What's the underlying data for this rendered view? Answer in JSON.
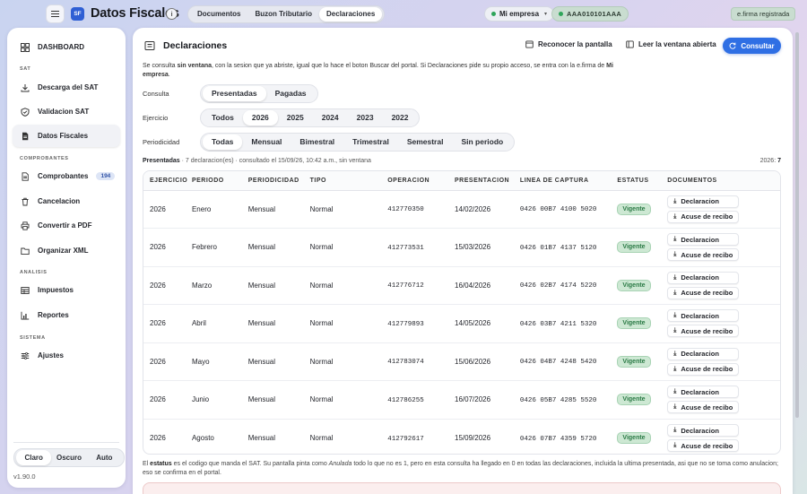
{
  "topbar": {
    "logo_text": "SF",
    "app_title": "Datos Fiscales",
    "info_icon": "info-icon",
    "tabs": [
      {
        "label": "Documentos",
        "active": false
      },
      {
        "label": "Buzon Tributario",
        "active": false
      },
      {
        "label": "Declaraciones",
        "active": true
      }
    ],
    "company": "Mi empresa",
    "rfc": "AAA010101AAA",
    "efirma": "e.firma registrada"
  },
  "sidebar": {
    "dashboard": "DASHBOARD",
    "sections": {
      "sat": "SAT",
      "comprobantes": "COMPROBANTES",
      "analisis": "ANALISIS",
      "sistema": "SISTEMA"
    },
    "items": {
      "descarga": "Descarga del SAT",
      "validacion": "Validacion SAT",
      "datos": "Datos Fiscales",
      "comprobantes": "Comprobantes",
      "comprobantes_count": "194",
      "cancelacion": "Cancelacion",
      "convertir": "Convertir a PDF",
      "organizar": "Organizar XML",
      "impuestos": "Impuestos",
      "reportes": "Reportes",
      "ajustes": "Ajustes"
    },
    "theme": {
      "claro": "Claro",
      "oscuro": "Oscuro",
      "auto": "Auto",
      "selected": "Claro"
    },
    "version": "v1.90.0"
  },
  "main": {
    "title": "Declaraciones",
    "reconocer": "Reconocer la pantalla",
    "leer": "Leer la ventana abierta",
    "consultar": "Consultar",
    "intro": {
      "p1": "Se consulta ",
      "b1": "sin ventana",
      "p2": ", con la sesion que ya abriste, igual que lo hace el boton Buscar del portal. Si Declaraciones pide su propio acceso, se entra con la e.firma de ",
      "b2": "Mi empresa",
      "p3": "."
    },
    "consulta_label": "Consulta",
    "consulta_opts": [
      "Presentadas",
      "Pagadas"
    ],
    "ejercicio_label": "Ejercicio",
    "ejercicio_opts": [
      "Todos",
      "2026",
      "2025",
      "2024",
      "2023",
      "2022"
    ],
    "periodicidad_label": "Periodicidad",
    "periodicidad_opts": [
      "Todas",
      "Mensual",
      "Bimestral",
      "Trimestral",
      "Semestral",
      "Sin periodo"
    ],
    "summary": {
      "bold": "Presentadas",
      "text": " · 7 declaracion(es) · consultado el 15/09/26, 10:42 a.m., sin ventana"
    },
    "year_count_label": "2026: ",
    "year_count": "7",
    "columns": [
      "EJERCICIO",
      "PERIODO",
      "PERIODICIDAD",
      "TIPO",
      "OPERACION",
      "PRESENTACION",
      "LINEA DE CAPTURA",
      "ESTATUS",
      "DOCUMENTOS"
    ],
    "doc_labels": {
      "declaracion": "Declaracion",
      "acuse": "Acuse de recibo"
    },
    "rows": [
      {
        "ejercicio": "2026",
        "periodo": "Enero",
        "periodicidad": "Mensual",
        "tipo": "Normal",
        "operacion": "412770350",
        "presentacion": "14/02/2026",
        "linea": "0426 00B7 4100 5020",
        "estatus": "Vigente"
      },
      {
        "ejercicio": "2026",
        "periodo": "Febrero",
        "periodicidad": "Mensual",
        "tipo": "Normal",
        "operacion": "412773531",
        "presentacion": "15/03/2026",
        "linea": "0426 01B7 4137 5120",
        "estatus": "Vigente"
      },
      {
        "ejercicio": "2026",
        "periodo": "Marzo",
        "periodicidad": "Mensual",
        "tipo": "Normal",
        "operacion": "412776712",
        "presentacion": "16/04/2026",
        "linea": "0426 02B7 4174 5220",
        "estatus": "Vigente"
      },
      {
        "ejercicio": "2026",
        "periodo": "Abril",
        "periodicidad": "Mensual",
        "tipo": "Normal",
        "operacion": "412779893",
        "presentacion": "14/05/2026",
        "linea": "0426 03B7 4211 5320",
        "estatus": "Vigente"
      },
      {
        "ejercicio": "2026",
        "periodo": "Mayo",
        "periodicidad": "Mensual",
        "tipo": "Normal",
        "operacion": "412783074",
        "presentacion": "15/06/2026",
        "linea": "0426 04B7 4248 5420",
        "estatus": "Vigente"
      },
      {
        "ejercicio": "2026",
        "periodo": "Junio",
        "periodicidad": "Mensual",
        "tipo": "Normal",
        "operacion": "412786255",
        "presentacion": "16/07/2026",
        "linea": "0426 05B7 4285 5520",
        "estatus": "Vigente"
      },
      {
        "ejercicio": "2026",
        "periodo": "Agosto",
        "periodicidad": "Mensual",
        "tipo": "Normal",
        "operacion": "412792617",
        "presentacion": "15/09/2026",
        "linea": "0426 07B7 4359 5720",
        "estatus": "Vigente"
      }
    ],
    "footnote": {
      "p1": "El ",
      "b1": "estatus",
      "p2": " es el codigo que manda el SAT. Su pantalla pinta como ",
      "i1": "Anulada",
      "p3": " todo lo que no es 1, pero en esta consulta ha llegado en 0 en todas las declaraciones, incluida la ultima presentada, asi que no se toma como anulacion; eso se confirma en el portal."
    }
  }
}
